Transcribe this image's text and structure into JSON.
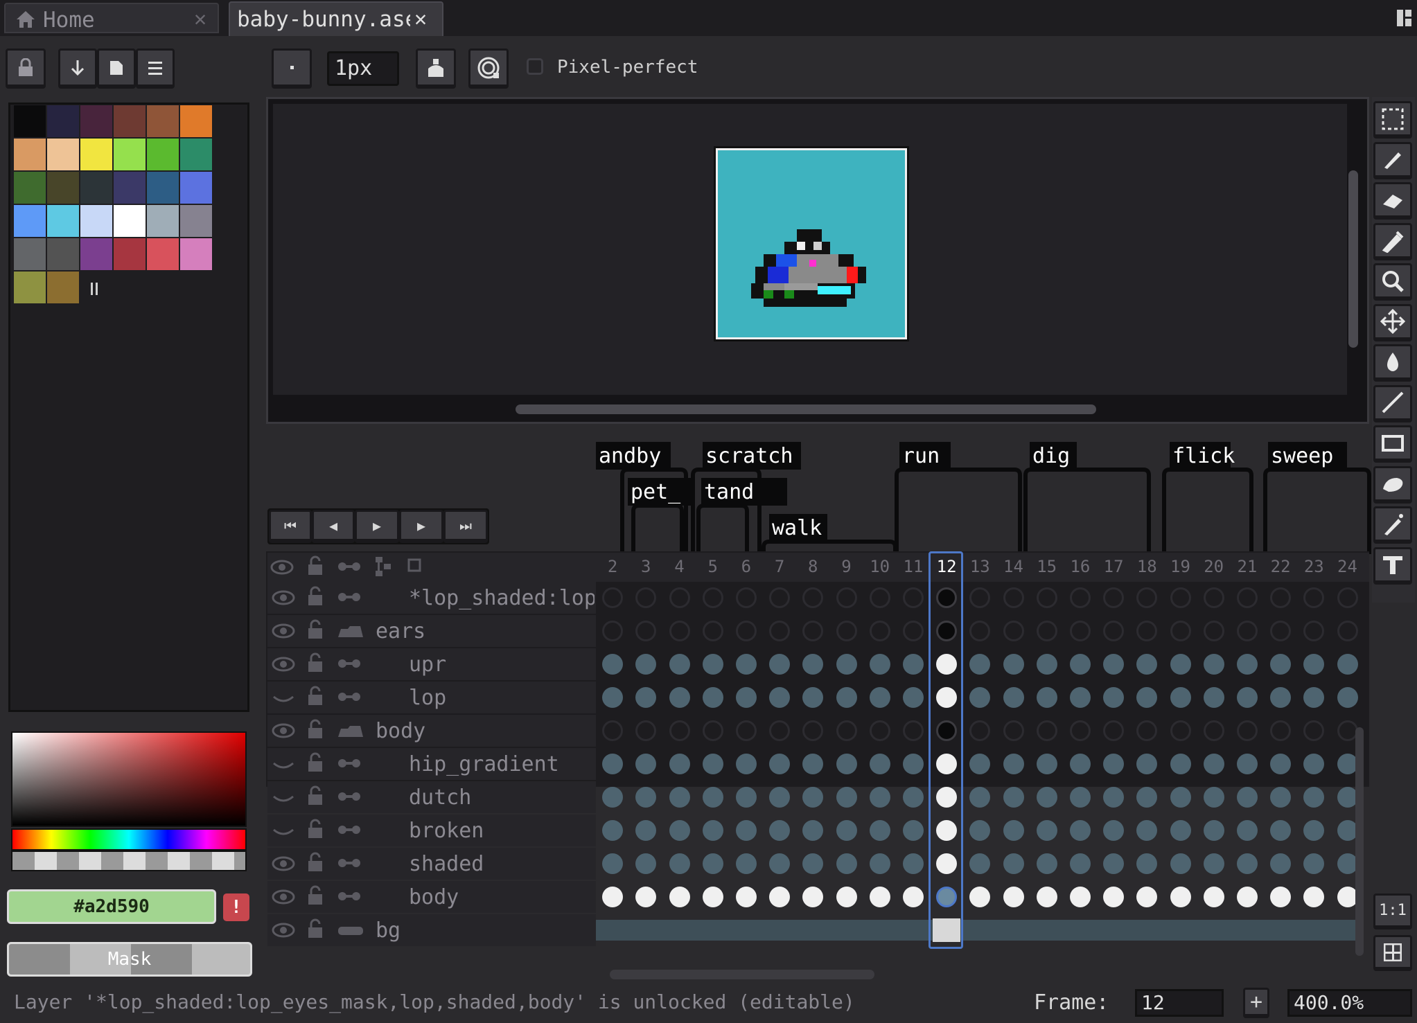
{
  "tabs": [
    {
      "label": "Home",
      "icon": "home-icon",
      "active": false
    },
    {
      "label": "baby-bunny.ase",
      "active": true
    }
  ],
  "toolbar": {
    "brush_size": "1px",
    "pixel_perfect_label": "Pixel-perfect",
    "pixel_perfect_checked": false
  },
  "palette": {
    "colors": [
      "#0b0b0c",
      "#262440",
      "#48243c",
      "#6e3a32",
      "#8f5538",
      "#e07a2a",
      "#d99a63",
      "#eec396",
      "#f1e540",
      "#95e04d",
      "#5bba2f",
      "#2c8c68",
      "#3f6b2e",
      "#484529",
      "#2c3438",
      "#3b3967",
      "#2d5d85",
      "#5c72e0",
      "#5e9af7",
      "#5ec9e3",
      "#c8d8f7",
      "#ffffff",
      "#9fadb7",
      "#868290",
      "#636568",
      "#535353",
      "#7b3f8f",
      "#a63640",
      "#d8525c",
      "#d57fbd",
      "#8e9241",
      "#8c6e30"
    ]
  },
  "color": {
    "hex": "#a2d590",
    "mask_label": "Mask"
  },
  "tags": [
    {
      "label": "andby"
    },
    {
      "label": "scratch"
    },
    {
      "label": "pet_"
    },
    {
      "label": "tand"
    },
    {
      "label": "walk"
    },
    {
      "label": "run"
    },
    {
      "label": "dig"
    },
    {
      "label": "flick"
    },
    {
      "label": "sweep"
    }
  ],
  "timeline": {
    "frames": [
      "2",
      "3",
      "4",
      "5",
      "6",
      "7",
      "8",
      "9",
      "10",
      "11",
      "12",
      "13",
      "14",
      "15",
      "16",
      "17",
      "18",
      "19",
      "20",
      "21",
      "22",
      "23",
      "24"
    ],
    "current_frame_index": 10,
    "layers": [
      {
        "name": "*lop_shaded:lop",
        "visible": true,
        "indent": 1,
        "kind": "layer",
        "cel": "empty"
      },
      {
        "name": "ears",
        "visible": true,
        "indent": 0,
        "kind": "group",
        "cel": "empty"
      },
      {
        "name": "upr",
        "visible": true,
        "indent": 1,
        "kind": "layer",
        "cel": "filled"
      },
      {
        "name": "lop",
        "visible": false,
        "indent": 1,
        "kind": "layer",
        "cel": "filled"
      },
      {
        "name": "body",
        "visible": true,
        "indent": 0,
        "kind": "group",
        "cel": "empty"
      },
      {
        "name": "hip_gradient",
        "visible": false,
        "indent": 1,
        "kind": "layer",
        "cel": "filled"
      },
      {
        "name": "dutch",
        "visible": false,
        "indent": 1,
        "kind": "layer",
        "cel": "filled"
      },
      {
        "name": "broken",
        "visible": false,
        "indent": 1,
        "kind": "layer",
        "cel": "filled"
      },
      {
        "name": "shaded",
        "visible": true,
        "indent": 1,
        "kind": "layer",
        "cel": "filled"
      },
      {
        "name": "body",
        "visible": true,
        "indent": 1,
        "kind": "layer",
        "cel": "active"
      },
      {
        "name": "bg",
        "visible": true,
        "indent": 0,
        "kind": "bg",
        "cel": "bar"
      }
    ]
  },
  "status": {
    "message": "Layer '*lop_shaded:lop_eyes_mask,lop,shaded,body' is unlocked (editable)",
    "frame_label": "Frame:",
    "frame_value": "12",
    "add_label": "+",
    "zoom": "400.0%"
  },
  "right_tools": [
    "marquee-icon",
    "pencil-icon",
    "eraser-icon",
    "eyedropper-icon",
    "zoom-icon",
    "move-icon",
    "fill-icon",
    "line-icon",
    "rectangle-icon",
    "blur-icon",
    "contour-icon",
    "text-icon"
  ],
  "zoom_reset_label": "1:1"
}
